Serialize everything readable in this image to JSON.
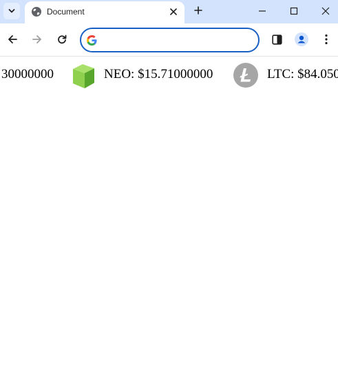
{
  "browser": {
    "tab_title": "Document",
    "address_placeholder": "",
    "icons": {
      "tab_search": "chevron-down-icon",
      "favicon": "globe-icon",
      "tab_close": "close-icon",
      "new_tab": "plus-icon",
      "minimize": "minimize-icon",
      "maximize": "maximize-icon",
      "close_window": "close-icon",
      "back": "arrow-left-icon",
      "forward": "arrow-right-icon",
      "reload": "reload-icon",
      "search_engine": "google-icon",
      "side_panel": "side-panel-icon",
      "profile": "profile-icon",
      "menu": "kebab-menu-icon"
    },
    "colors": {
      "tabstrip": "#d3e3fd",
      "omnibox_border": "#1a5fc4"
    }
  },
  "ticker": {
    "items": [
      {
        "text": "30000000",
        "icon": null
      },
      {
        "text": "NEO: $15.71000000",
        "icon": "neo-logo"
      },
      {
        "text": "LTC: $84.050",
        "icon": "litecoin-logo"
      }
    ],
    "colors": {
      "neo_light": "#8fd14f",
      "neo_dark": "#58a62b",
      "ltc_circle": "#a6a6a6"
    }
  }
}
